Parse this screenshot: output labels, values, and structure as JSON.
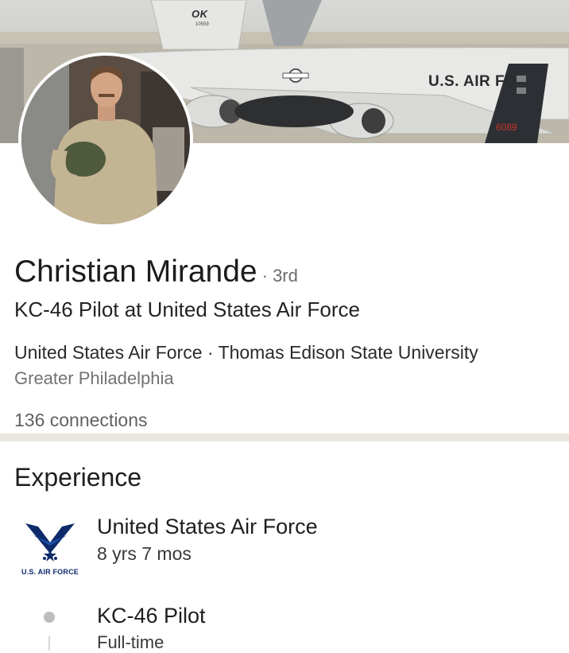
{
  "cover": {
    "tail_code": "OK",
    "tail_number": "10559",
    "fuselage_text": "U.S. AIR FO",
    "tail_serial": "6089"
  },
  "profile": {
    "name": "Christian Mirande",
    "degree": "· 3rd",
    "headline": "KC-46 Pilot at United States Air Force",
    "orgs": "United States Air Force · Thomas Edison State University",
    "location": "Greater Philadelphia",
    "connections": "136 connections"
  },
  "experience": {
    "section_title": "Experience",
    "company": {
      "logo_text": "U.S. AIR FORCE",
      "name": "United States Air Force",
      "tenure": "8 yrs 7 mos"
    },
    "roles": [
      {
        "title": "KC-46 Pilot",
        "type": "Full-time"
      }
    ]
  },
  "colors": {
    "divider": "#e9e6df",
    "air_force_blue": "#0e2a6b",
    "secondary_text": "#727272"
  }
}
